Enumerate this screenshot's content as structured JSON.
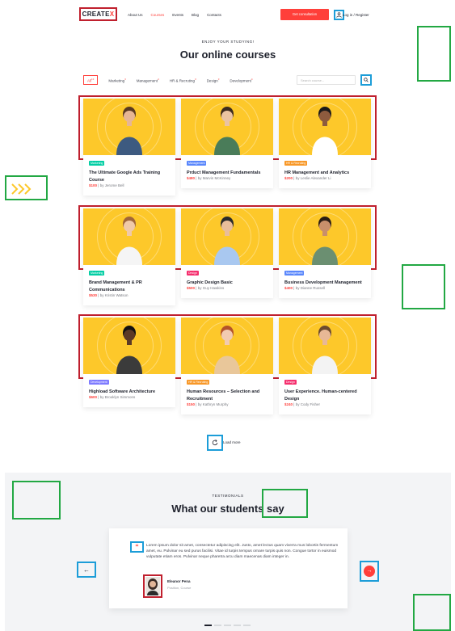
{
  "header": {
    "logo_main": "CREATE",
    "logo_accent": "X",
    "nav": [
      "About Us",
      "Courses",
      "Events",
      "Blog",
      "Contacts"
    ],
    "nav_active": 1,
    "cta": "Get consultation",
    "login": "Log in / Register"
  },
  "courses": {
    "eyebrow": "ENJOY YOUR STUDYING!",
    "title": "Our online courses",
    "filters": [
      {
        "label": "All",
        "count": "13",
        "active": true
      },
      {
        "label": "Marketing",
        "count": "3"
      },
      {
        "label": "Management",
        "count": "4"
      },
      {
        "label": "HR & Recruting",
        "count": "3"
      },
      {
        "label": "Design",
        "count": "3"
      },
      {
        "label": "Development",
        "count": "4"
      }
    ],
    "search_placeholder": "Search course...",
    "cards": [
      {
        "category": "Marketing",
        "title": "The Ultimate Google Ads Training Course",
        "price": "$100",
        "author": "by Jerome Bell"
      },
      {
        "category": "Management",
        "title": "Prduct Management Fundamentals",
        "price": "$480",
        "author": "by Marvin McKinney"
      },
      {
        "category": "HR & Recruting",
        "title": "HR  Management and Analytics",
        "price": "$200",
        "author": "by Leslie Alexander Li"
      },
      {
        "category": "Marketing",
        "title": "Brand Management & PR Communications",
        "price": "$530",
        "author": "by Kristin Watson"
      },
      {
        "category": "Design",
        "title": "Graphic Design Basic",
        "price": "$500",
        "author": "by Guy Hawkins"
      },
      {
        "category": "Management",
        "title": "Business Development Management",
        "price": "$400",
        "author": "by Dianne Russell"
      },
      {
        "category": "Development",
        "title": "Highload Software Architecture",
        "price": "$600",
        "author": "by Brooklyn Simmons"
      },
      {
        "category": "HR & Recruting",
        "title": "Human Resources – Selection and Recruitment",
        "price": "$150",
        "author": "by Kathryn Murphy"
      },
      {
        "category": "Design",
        "title": "User Experience. Human-centered Design",
        "price": "$240",
        "author": "by Cody Fisher"
      }
    ],
    "load_more": "Load more"
  },
  "testimonials": {
    "eyebrow": "TESTIMONIALS",
    "title": "What our students say",
    "quote_mark": "“",
    "text": "Lorem ipsum dolor sit amet, consectetur adipiscing elit. Justo, amet lectus quam viverra mus lobortis fermentum amet, eu. Pulvinar eu sed purus facilisi. Vitae id turpis tempus ornare turpis quis non. Congue tortor in euismod vulputate etiam eros. Pulvinar neque pharetra arcu diam maecenas diam integer in.",
    "author": "Eleanor Pena",
    "role": "Position, Course",
    "prev": "←",
    "next": "→"
  },
  "colors": {
    "accent": "#ff3f3a",
    "card_image_bg": "#fdc82a",
    "marketing": "#03cea4",
    "management": "#5a87fc",
    "hr": "#f89828",
    "design": "#f52f6e",
    "development": "#7e7bff"
  },
  "icons": {
    "login": "user-icon",
    "search": "search-icon",
    "load_more": "refresh-icon",
    "quote": "quote-icon",
    "prev": "arrow-left-icon",
    "next": "arrow-right-icon"
  }
}
